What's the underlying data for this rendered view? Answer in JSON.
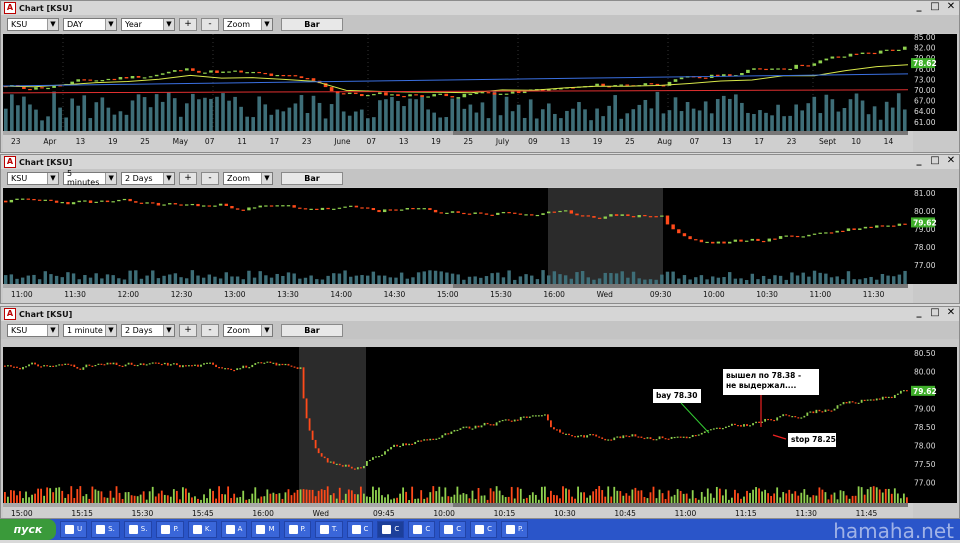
{
  "windows": [
    {
      "title": "Chart [KSU]",
      "symbol": "KSU",
      "period": "DAY",
      "range": "Year",
      "zoom": "Zoom",
      "plus": "+",
      "minus": "-",
      "bar_label": "Bar",
      "price_labels": [
        "85.00",
        "82.00",
        "79.00",
        "76.00",
        "73.00",
        "70.00",
        "67.00",
        "64.00",
        "61.00"
      ],
      "last_price": "78.62",
      "x_labels": [
        "23",
        "Apr",
        "13",
        "19",
        "25",
        "May",
        "07",
        "11",
        "17",
        "23",
        "June",
        "07",
        "13",
        "19",
        "25",
        "July",
        "09",
        "13",
        "19",
        "25",
        "Aug",
        "07",
        "13",
        "17",
        "23",
        "Sept",
        "10",
        "14"
      ]
    },
    {
      "title": "Chart [KSU]",
      "symbol": "KSU",
      "period": "5 minutes",
      "range": "2 Days",
      "zoom": "Zoom",
      "plus": "+",
      "minus": "-",
      "bar_label": "Bar",
      "price_labels": [
        "81.00",
        "80.00",
        "79.00",
        "78.00",
        "77.00"
      ],
      "last_price": "79.62",
      "x_labels": [
        "11:00",
        "11:30",
        "12:00",
        "12:30",
        "13:00",
        "13:30",
        "14:00",
        "14:30",
        "15:00",
        "15:30",
        "16:00",
        "Wed",
        "09:30",
        "10:00",
        "10:30",
        "11:00",
        "11:30"
      ]
    },
    {
      "title": "Chart [KSU]",
      "symbol": "KSU",
      "period": "1 minute",
      "range": "2 Days",
      "zoom": "Zoom",
      "plus": "+",
      "minus": "-",
      "bar_label": "Bar",
      "price_labels": [
        "80.50",
        "80.00",
        "79.50",
        "79.00",
        "78.50",
        "78.00",
        "77.50",
        "77.00"
      ],
      "last_price": "79.62",
      "x_labels": [
        "15:00",
        "15:15",
        "15:30",
        "15:45",
        "16:00",
        "Wed",
        "09:45",
        "10:00",
        "10:15",
        "10:30",
        "10:45",
        "11:00",
        "11:15",
        "11:30",
        "11:45"
      ],
      "annotations": {
        "buy": "bay 78.30",
        "exit": "вышел по 78.38 - не выдержал....",
        "stop": "stop 78.25"
      }
    }
  ],
  "colors": {
    "up": "#8fd14f",
    "down": "#ff4a1a",
    "last_price_bg": "#3fae2a",
    "volume": "#3e6e78",
    "ma_yellow": "#d8e84a",
    "ma_blue": "#3a6fe0",
    "ma_red": "#e03030"
  },
  "taskbar": {
    "start": "пуск",
    "items": [
      "U",
      "S.",
      "S.",
      "P.",
      "K.",
      "A",
      "M",
      "P.",
      "T.",
      "C",
      "C",
      "C",
      "C",
      "C",
      "P."
    ],
    "watermark": "hamaha.net"
  }
}
